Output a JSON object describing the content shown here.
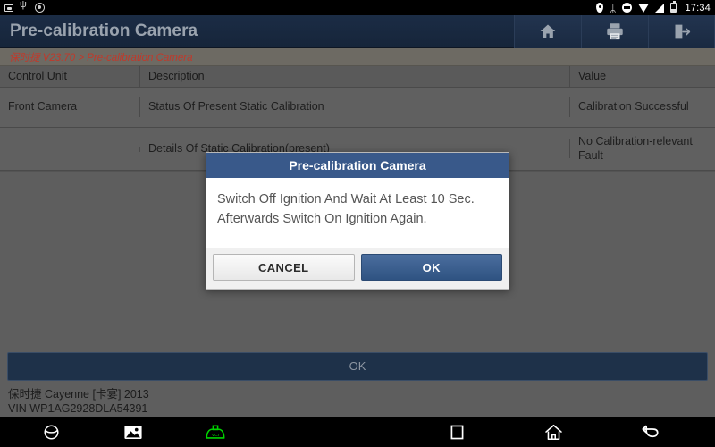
{
  "statusbar": {
    "time": "17:34",
    "left_icons": [
      "sd-card-icon",
      "usb-icon",
      "settings-icon"
    ],
    "right_icons": [
      "location-pin-icon",
      "bluetooth-icon",
      "do-not-disturb-icon",
      "wifi-icon",
      "cellular-signal-icon",
      "battery-icon"
    ],
    "bluetooth_glyph": "ᛦ"
  },
  "header": {
    "title": "Pre-calibration Camera",
    "actions": [
      {
        "name": "home-button",
        "icon": "home-icon"
      },
      {
        "name": "print-button",
        "icon": "printer-icon"
      },
      {
        "name": "exit-button",
        "icon": "exit-icon"
      }
    ]
  },
  "breadcrumb": {
    "text": "保时捷 V23.70 > Pre-calibration Camera"
  },
  "table": {
    "columns": [
      "Control Unit",
      "Description",
      "Value"
    ],
    "rows": [
      {
        "control_unit": "Front Camera",
        "description": "Status Of Present Static Calibration",
        "value": "Calibration Successful"
      },
      {
        "control_unit": "",
        "description": "Details Of Static Calibration(present)",
        "value": "No Calibration-relevant Fault"
      }
    ]
  },
  "bottom_bar": {
    "ok_label": "OK"
  },
  "footer": {
    "vehicle": "保时捷 Cayenne [卡宴] 2013",
    "vin": "VIN WP1AG2928DLA54391"
  },
  "dialog": {
    "title": "Pre-calibration Camera",
    "message": "Switch Off Ignition And Wait At Least 10 Sec.\nAfterwards Switch On Ignition Again.",
    "cancel_label": "CANCEL",
    "ok_label": "OK"
  },
  "navbar": {
    "left": [
      {
        "name": "browser-icon"
      },
      {
        "name": "gallery-icon"
      },
      {
        "name": "vci-icon",
        "label": "VCI"
      }
    ],
    "right": [
      {
        "name": "recent-apps-icon"
      },
      {
        "name": "home-nav-icon"
      },
      {
        "name": "back-nav-icon"
      }
    ]
  },
  "colors": {
    "appbar": "#1b2c45",
    "breadcrumb_text": "#c0392b",
    "dialog_title_bg": "#39598a",
    "dialog_ok_bg": "#2f5382",
    "vci_green": "#00d400",
    "page_bg": "#5e5e5e"
  }
}
